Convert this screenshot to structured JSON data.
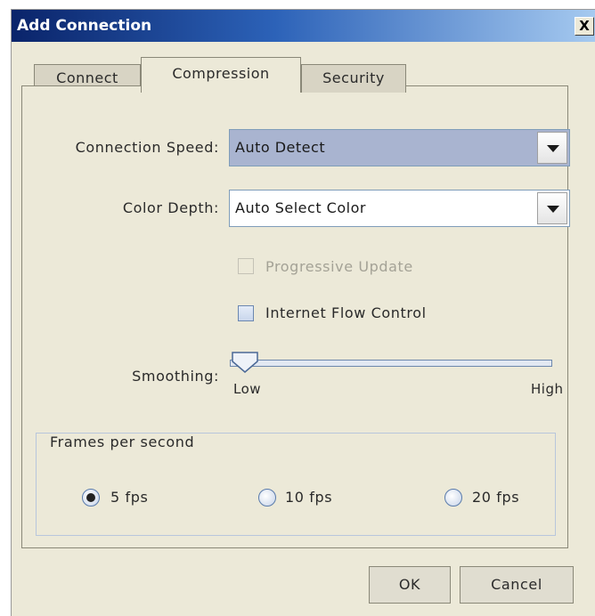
{
  "window": {
    "title": "Add Connection",
    "close_glyph": "X"
  },
  "tabs": [
    {
      "label": "Connect",
      "active": false
    },
    {
      "label": "Compression",
      "active": true
    },
    {
      "label": "Security",
      "active": false
    }
  ],
  "connection_speed": {
    "label": "Connection Speed:",
    "value": "Auto Detect"
  },
  "color_depth": {
    "label": "Color Depth:",
    "value": "Auto Select Color"
  },
  "progressive_update": {
    "label": "Progressive Update",
    "checked": false,
    "enabled": false
  },
  "internet_flow_control": {
    "label": "Internet Flow Control",
    "checked": false,
    "enabled": true
  },
  "smoothing": {
    "label": "Smoothing:",
    "min_label": "Low",
    "max_label": "High",
    "level": 0
  },
  "frames_per_second": {
    "title": "Frames per second",
    "options": [
      {
        "label": "5 fps",
        "checked": true
      },
      {
        "label": "10 fps",
        "checked": false
      },
      {
        "label": "20 fps",
        "checked": false
      }
    ]
  },
  "buttons": {
    "ok": "OK",
    "cancel": "Cancel"
  },
  "colors": {
    "title_bar_start": "#0a246a",
    "title_bar_end": "#a6caf0",
    "dialog_bg": "#ece9d8"
  }
}
